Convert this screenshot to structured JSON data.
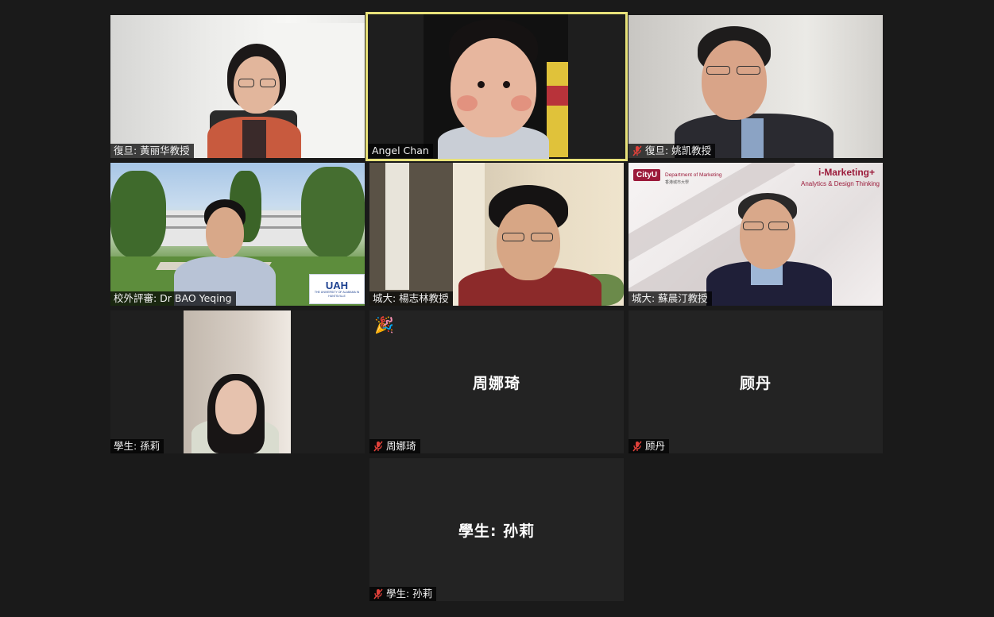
{
  "participants": [
    {
      "label": "復旦: 黃丽华教授",
      "muted": false
    },
    {
      "label": "Angel Chan",
      "muted": false
    },
    {
      "label": "復旦: 姚凯教授",
      "muted": true
    },
    {
      "label": "校外評審: Dr BAO Yeqing",
      "muted": false
    },
    {
      "label": "城大: 楊志林教授",
      "muted": false
    },
    {
      "label": "城大: 蘇晨汀教授",
      "muted": false
    },
    {
      "label": "學生: 孫莉",
      "muted": false
    },
    {
      "label": "周娜琦",
      "muted": true,
      "display_name": "周娜琦",
      "reaction": "🎉"
    },
    {
      "label": "顾丹",
      "muted": true,
      "display_name": "顾丹"
    },
    {
      "label": "學生: 孙莉",
      "muted": true,
      "display_name": "學生: 孙莉"
    }
  ],
  "backgrounds": {
    "uah_logo_text": "UAH",
    "uah_sub_text": "THE UNIVERSITY OF ALABAMA IN HUNTSVILLE",
    "cityu_logo": "CityU",
    "cityu_dept": "Department of Marketing",
    "cityu_dept_sub": "香港城市大學",
    "imarketing_title": "i-Marketing+",
    "imarketing_sub": "Analytics & Design Thinking"
  },
  "colors": {
    "active_speaker": "#e8e27a",
    "muted_icon": "#e0413a",
    "page_bg": "#1a1a1a",
    "tile_bg": "#232323"
  }
}
